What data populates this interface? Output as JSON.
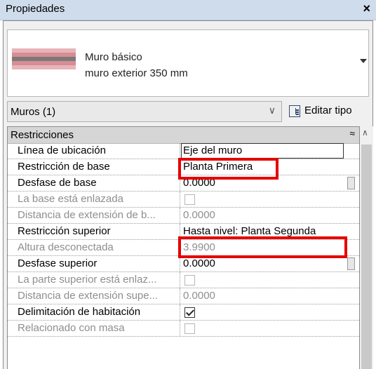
{
  "panel": {
    "title": "Propiedades",
    "close_glyph": "✕"
  },
  "type_selector": {
    "family": "Muro básico",
    "type": "muro exterior 350 mm"
  },
  "filter": {
    "selected": "Muros (1)",
    "edit_type_label": "Editar tipo"
  },
  "section": {
    "label": "Restricciones",
    "collapse_glyph": "≈"
  },
  "rows": [
    {
      "name": "Línea de ubicación",
      "value": "Eje del muro"
    },
    {
      "name": "Restricción de base",
      "value": "Planta Primera"
    },
    {
      "name": "Desfase de base",
      "value": "0.0000"
    },
    {
      "name": "La base está enlazada",
      "value": ""
    },
    {
      "name": "Distancia de extensión de b...",
      "value": "0.0000"
    },
    {
      "name": "Restricción superior",
      "value": "Hasta nivel: Planta Segunda"
    },
    {
      "name": "Altura desconectada",
      "value": "3.9900"
    },
    {
      "name": "Desfase superior",
      "value": "0.0000"
    },
    {
      "name": "La parte superior está enlaz...",
      "value": ""
    },
    {
      "name": "Distancia de extensión supe...",
      "value": "0.0000"
    },
    {
      "name": "Delimitación de habitación",
      "value": ""
    },
    {
      "name": "Relacionado con masa",
      "value": ""
    }
  ],
  "colors": {
    "highlight": "#e60000",
    "titlebar": "#cfdcec",
    "section": "#d6d6d6"
  }
}
